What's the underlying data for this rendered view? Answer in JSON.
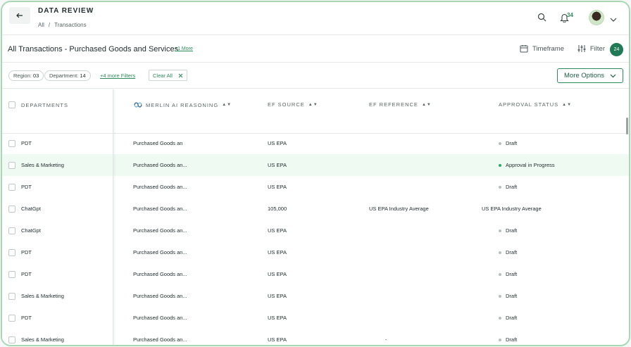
{
  "header": {
    "title": "DATA REVIEW",
    "breadcrumb": [
      "All",
      "/",
      "Transactions"
    ],
    "notification_count": "34"
  },
  "subheader": {
    "title": "All Transactions - Purchased Goods and Services",
    "more_link": "+1 More",
    "timeframe_label": "Timeframe",
    "filter_label": "Filter",
    "filter_count": "24"
  },
  "filters": {
    "region_label": "Region:",
    "region_value": "03",
    "department_label": "Department:",
    "department_value": "14",
    "more_filters": "+4 more Filters",
    "clear_all": "Clear All",
    "more_options": "More Options"
  },
  "table": {
    "columns": [
      "DEPARTMENTS",
      "MERLIN AI REASONING",
      "EF SOURCE",
      "EF REFERENCE",
      "APPROVAL STATUS"
    ],
    "rows": [
      {
        "department": "PDT",
        "reasoning": "Purchased Goods an",
        "ef_source": "US EPA",
        "ef_reference": "",
        "status": "Draft",
        "status_color": "#b9bfbd",
        "highlight": false
      },
      {
        "department": "Sales & Marketing",
        "reasoning": "Purchased Goods an...",
        "ef_source": "US EPA",
        "ef_reference": "",
        "status": "Approval in Progress",
        "status_color": "#2fa866",
        "highlight": true
      },
      {
        "department": "PDT",
        "reasoning": "Purchased Goods an...",
        "ef_source": "US EPA",
        "ef_reference": "",
        "status": "Draft",
        "status_color": "#b9bfbd",
        "highlight": false
      },
      {
        "department": "ChatGpt",
        "reasoning": "Purchased Goods an...",
        "ef_source": "105,000",
        "ef_reference": "US EPA Industry Average",
        "status": "US EPA Industry Average",
        "status_color": "",
        "highlight": false
      },
      {
        "department": "ChatGpt",
        "reasoning": "Purchased Goods an...",
        "ef_source": "US EPA",
        "ef_reference": "",
        "status": "Draft",
        "status_color": "#b9bfbd",
        "highlight": false
      },
      {
        "department": "PDT",
        "reasoning": "Purchased Goods an...",
        "ef_source": "US EPA",
        "ef_reference": "",
        "status": "Draft",
        "status_color": "#b9bfbd",
        "highlight": false
      },
      {
        "department": "PDT",
        "reasoning": "Purchased Goods an...",
        "ef_source": "US EPA",
        "ef_reference": "",
        "status": "Draft",
        "status_color": "#b9bfbd",
        "highlight": false
      },
      {
        "department": "Sales & Marketing",
        "reasoning": "Purchased Goods an...",
        "ef_source": "US EPA",
        "ef_reference": "",
        "status": "Draft",
        "status_color": "#b9bfbd",
        "highlight": false
      },
      {
        "department": "PDT",
        "reasoning": "Purchased Goods an...",
        "ef_source": "US EPA",
        "ef_reference": "",
        "status": "Draft",
        "status_color": "#b9bfbd",
        "highlight": false
      },
      {
        "department": "Sales & Marketing",
        "reasoning": "Purchased Goods an...",
        "ef_source": "US EPA",
        "ef_reference": "-",
        "status": "Draft",
        "status_color": "#b9bfbd",
        "highlight": false
      }
    ]
  },
  "icons": {
    "back": "arrow-left-icon",
    "search": "search-icon",
    "bell": "bell-icon",
    "calendar": "calendar-icon",
    "filter": "sliders-icon",
    "merlin": "merlin-ai-icon"
  },
  "colors": {
    "accent": "#2d8a5a",
    "badge": "#1f7a55",
    "frame": "#a9d7b3",
    "highlight_row": "#effaf3"
  }
}
